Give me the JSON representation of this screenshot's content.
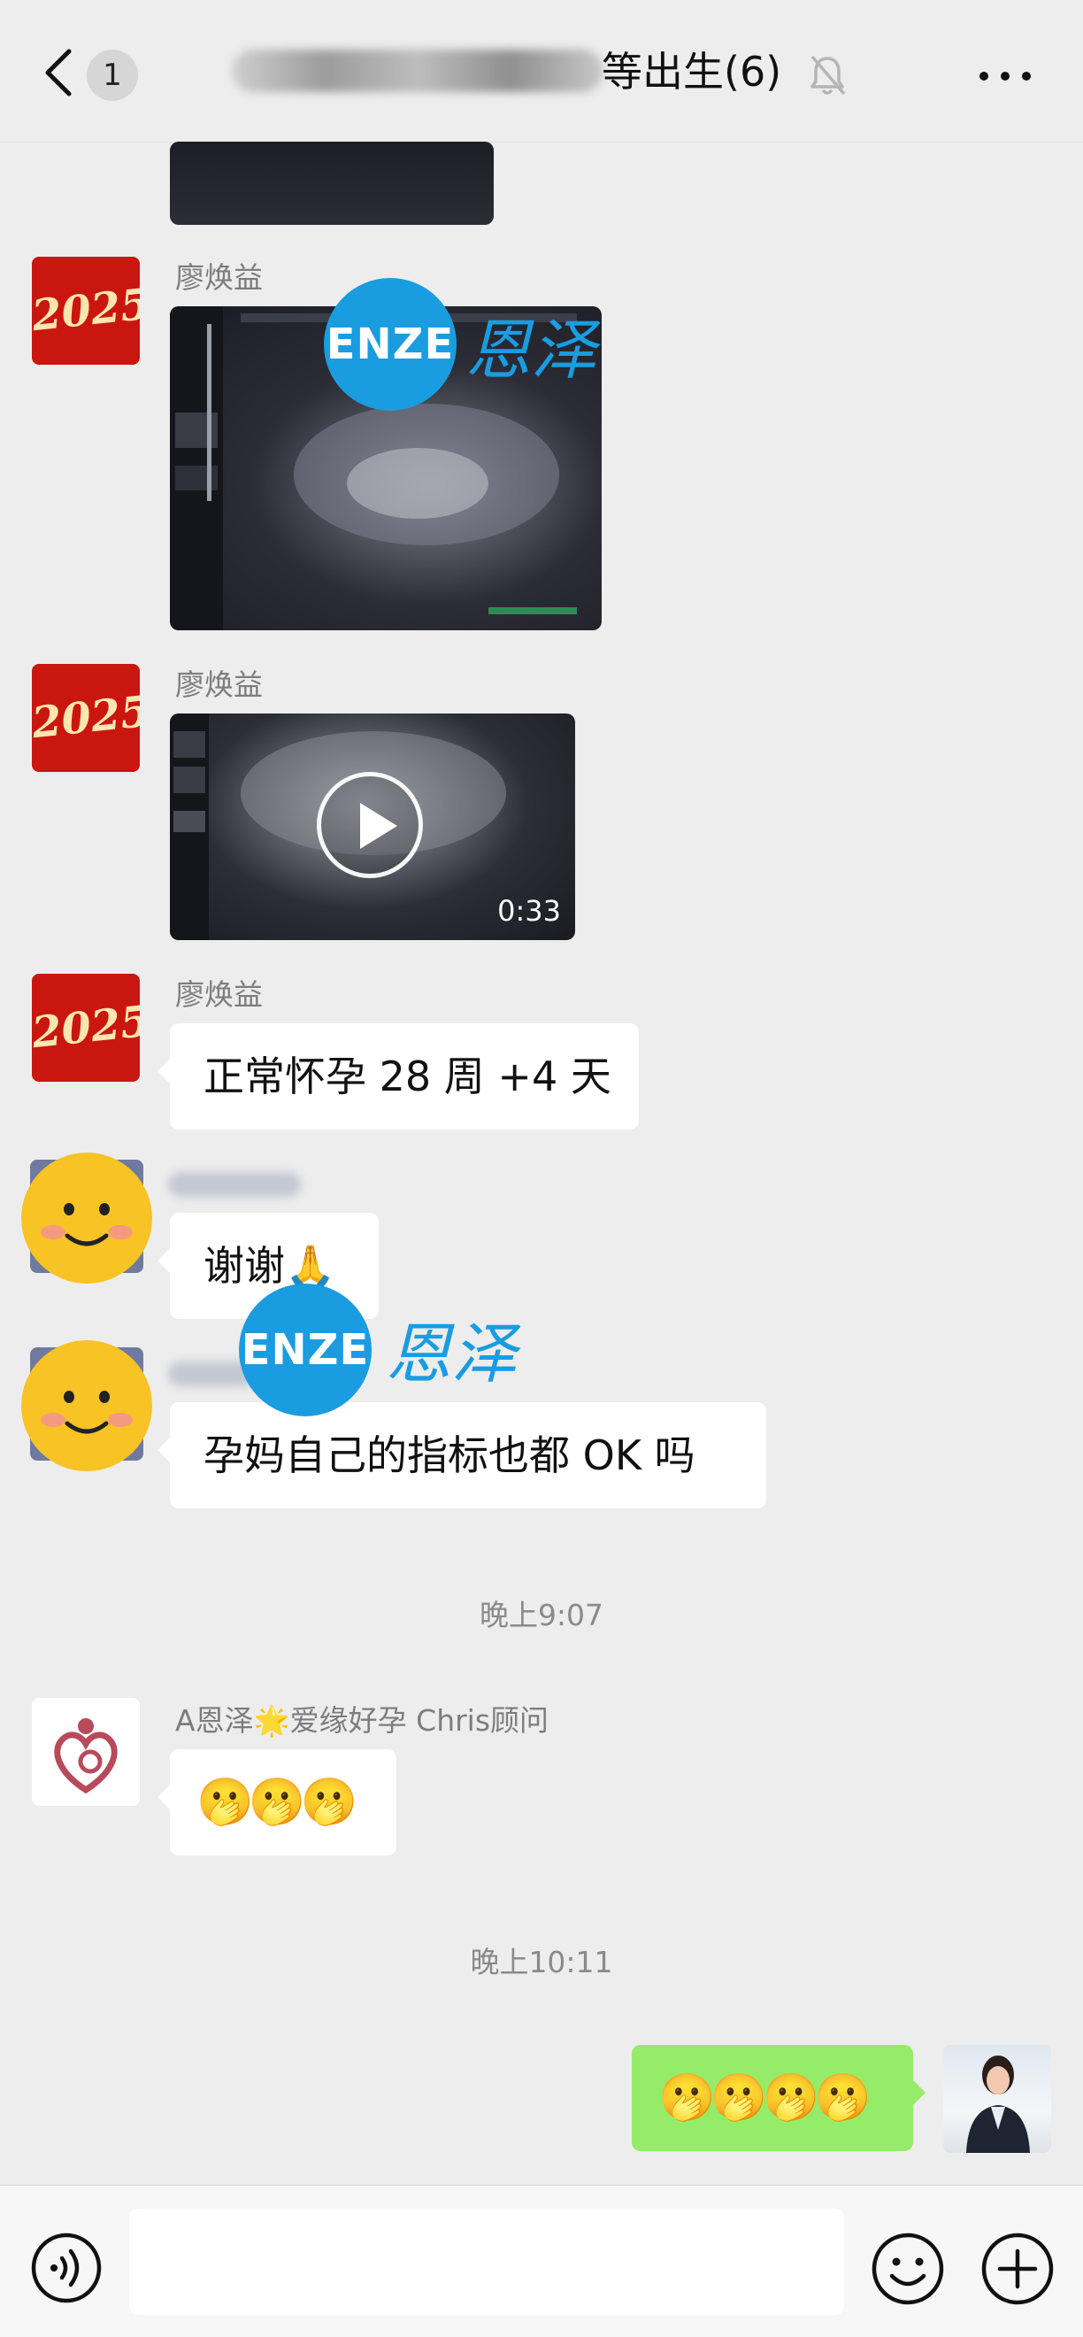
{
  "header": {
    "unread_count": "1",
    "title": "等出生(6)",
    "title_blurred": true,
    "icons": [
      "back-chevron-icon",
      "mute-bell-icon",
      "more-dots-icon"
    ]
  },
  "messages": [
    {
      "type": "image",
      "partial": true
    },
    {
      "sender": "廖焕益",
      "type": "image",
      "avatar": "2025"
    },
    {
      "sender": "廖焕益",
      "type": "video",
      "duration": "0:33",
      "avatar": "2025"
    },
    {
      "sender": "廖焕益",
      "type": "text",
      "text": "正常怀孕 28 周 +4 天",
      "avatar": "2025"
    },
    {
      "sender": "",
      "type": "text",
      "text": "谢谢🙏",
      "avatar": "smiley"
    },
    {
      "sender": "",
      "type": "text",
      "text": "孕妈自己的指标也都 OK 吗",
      "avatar": "smiley"
    },
    {
      "type": "timestamp",
      "text": "晚上9:07"
    },
    {
      "sender": "A恩泽🌟爱缘好孕 Chris顾问",
      "type": "text",
      "text": "🫢🫢🫢",
      "avatar": "logo"
    },
    {
      "type": "timestamp",
      "text": "晚上10:11"
    },
    {
      "sender": "me",
      "type": "text",
      "text": "🫢🫢🫢🫢",
      "side": "right"
    }
  ],
  "avatar_2025_text": "2025",
  "watermark": {
    "latin": "ENZE",
    "chinese": "恩泽"
  },
  "bottom_bar": {
    "input_value": "",
    "icons": [
      "voice-icon",
      "emoji-icon",
      "plus-icon"
    ]
  },
  "colors": {
    "background": "#ededed",
    "self_bubble": "#95ec69",
    "other_bubble": "#ffffff",
    "watermark_blue": "#1a9ce0",
    "avatar_red": "#c9170f"
  }
}
